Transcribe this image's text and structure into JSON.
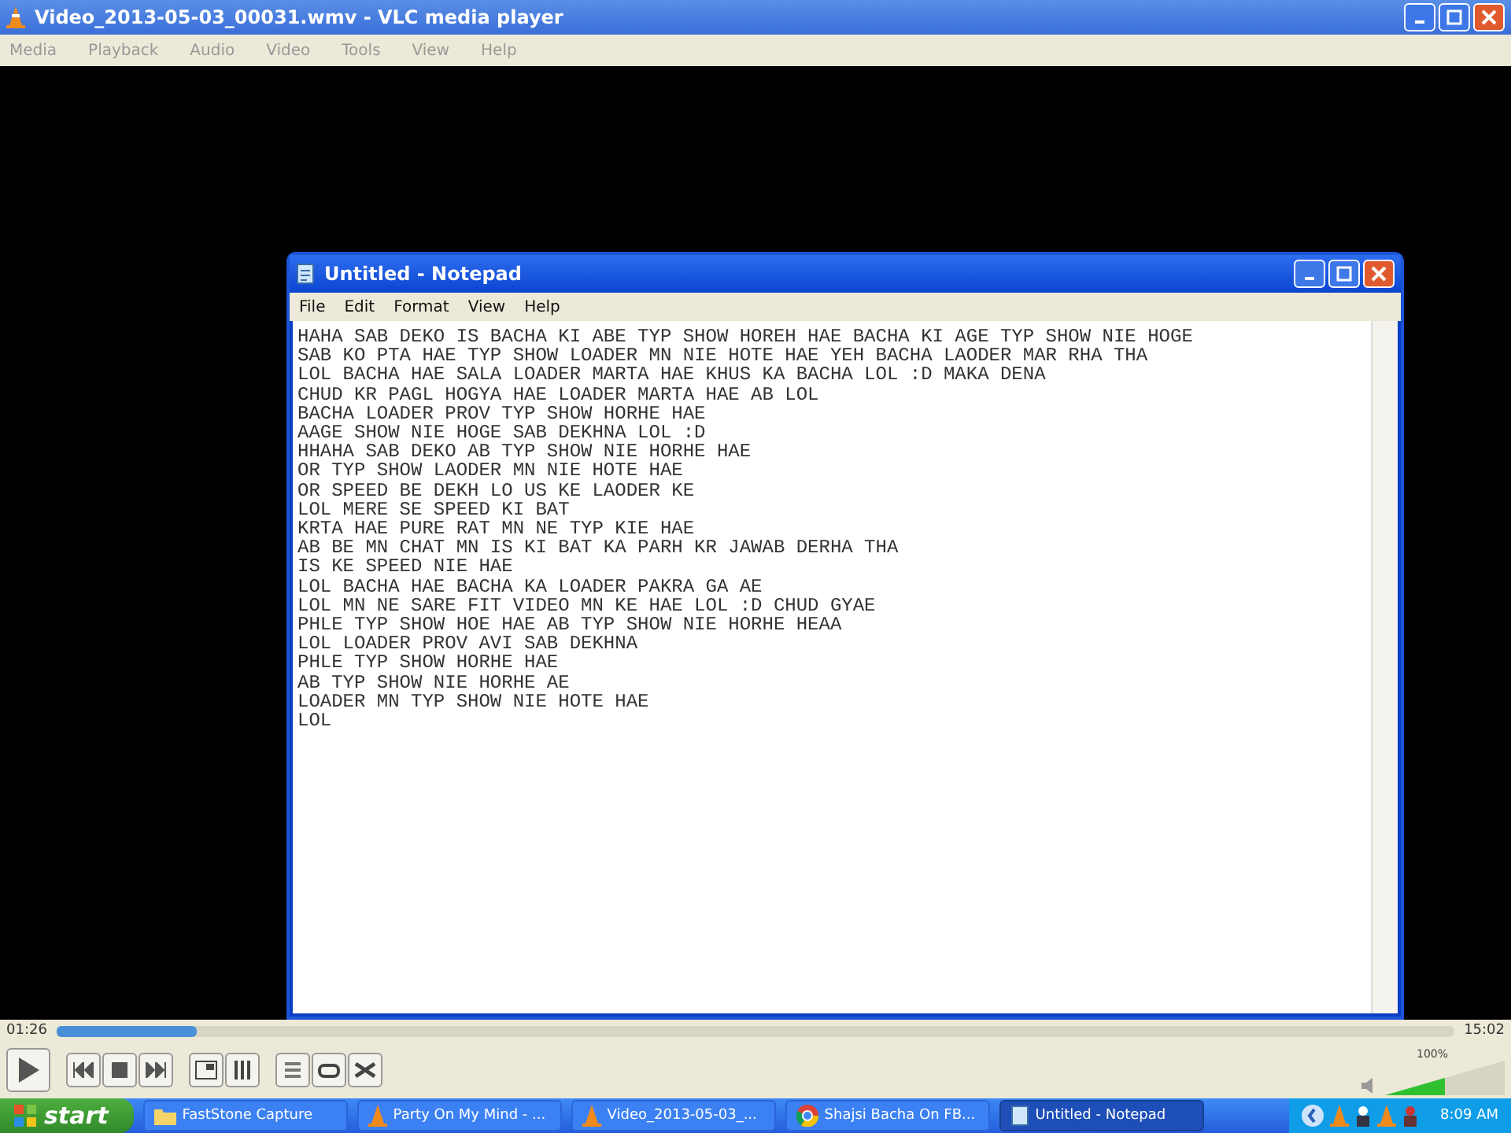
{
  "window": {
    "title": "Video_2013-05-03_00031.wmv - VLC media player"
  },
  "menu": [
    "Media",
    "Playback",
    "Audio",
    "Video",
    "Tools",
    "View",
    "Help"
  ],
  "notepad": {
    "title": "Untitled - Notepad",
    "menu": [
      "File",
      "Edit",
      "Format",
      "View",
      "Help"
    ],
    "lines": [
      "HAHA SAB DEKO IS BACHA KI ABE TYP SHOW HOREH HAE BACHA KI AGE TYP SHOW NIE HOGE",
      "SAB KO PTA HAE TYP SHOW LOADER MN NIE HOTE HAE YEH BACHA LAODER MAR RHA THA",
      "LOL BACHA HAE SALA LOADER MARTA HAE KHUS KA BACHA LOL :D MAKA DENA",
      "CHUD KR PAGL HOGYA HAE LOADER MARTA HAE AB LOL",
      "BACHA LOADER PROV TYP SHOW HORHE HAE",
      "AAGE SHOW NIE HOGE SAB DEKHNA LOL :D",
      "HHAHA SAB DEKO AB TYP SHOW NIE HORHE HAE",
      "OR TYP SHOW LAODER MN NIE HOTE HAE",
      "OR SPEED BE DEKH LO US KE LAODER KE",
      "LOL MERE SE SPEED KI BAT",
      "KRTA HAE PURE RAT MN NE TYP KIE HAE",
      "AB BE MN CHAT MN IS KI BAT KA PARH KR JAWAB DERHA THA",
      "IS KE SPEED NIE HAE",
      "LOL BACHA HAE BACHA KA LOADER PAKRA GA AE",
      "LOL MN NE SARE FIT VIDEO MN KE HAE LOL :D CHUD GYAE",
      "PHLE TYP SHOW HOE HAE AB TYP SHOW NIE HORHE HEAA",
      "LOL LOADER PROV AVI SAB DEKHNA",
      "PHLE TYP SHOW HORHE HAE",
      "AB TYP SHOW NIE HORHE AE",
      "LOADER MN TYP SHOW NIE HOTE HAE",
      "LOL"
    ]
  },
  "seek": {
    "elapsed": "01:26",
    "total": "15:02",
    "level": 0.1
  },
  "volume": {
    "reading": "100%",
    "level": 0.5
  },
  "taskbar": {
    "start": "start",
    "items": [
      {
        "label": "FastStone Capture",
        "kind": "folder",
        "selected": false
      },
      {
        "label": "Party On My Mind - ...",
        "kind": "cone",
        "selected": false
      },
      {
        "label": "Video_2013-05-03_...",
        "kind": "cone",
        "selected": false
      },
      {
        "label": "Shajsi Bacha On FB...",
        "kind": "chrome",
        "selected": false
      },
      {
        "label": "Untitled - Notepad",
        "kind": "notepad",
        "selected": true
      }
    ],
    "clock": "8:09 AM"
  }
}
